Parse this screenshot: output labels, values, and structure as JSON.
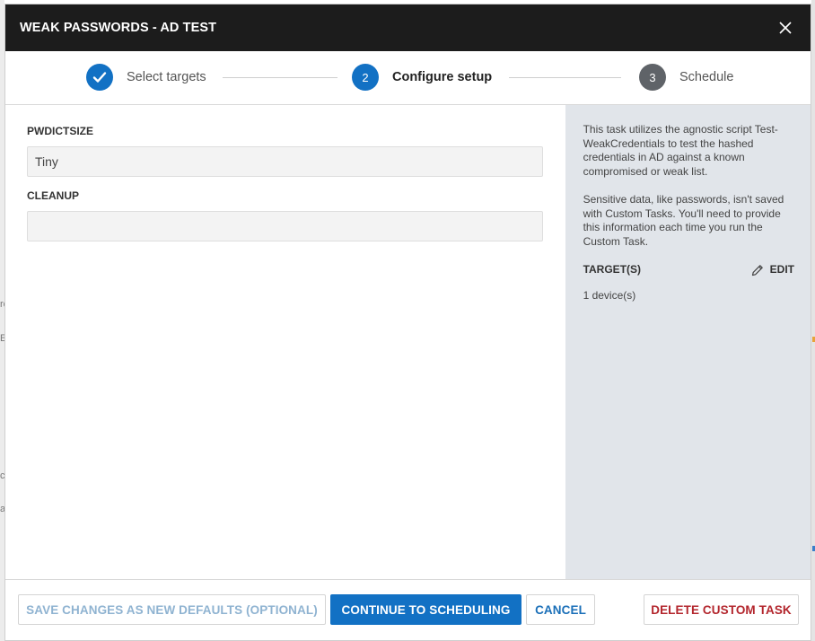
{
  "modal": {
    "title": "WEAK PASSWORDS - AD TEST"
  },
  "stepper": {
    "steps": [
      {
        "number": "",
        "label": "Select targets",
        "state": "complete"
      },
      {
        "number": "2",
        "label": "Configure setup",
        "state": "active"
      },
      {
        "number": "3",
        "label": "Schedule",
        "state": "pending"
      }
    ]
  },
  "form": {
    "fields": [
      {
        "label": "PWDICTSIZE",
        "value": "Tiny"
      },
      {
        "label": "CLEANUP",
        "value": ""
      }
    ]
  },
  "side_panel": {
    "description": "This task utilizes the agnostic script Test-WeakCredentials to test the hashed credentials in AD against a known compromised or weak list.",
    "notice": "Sensitive data, like passwords, isn't saved with Custom Tasks. You'll need to provide this information each time you run the Custom Task.",
    "targets_label": "TARGET(S)",
    "edit_label": "EDIT",
    "targets_count": "1 device(s)"
  },
  "footer": {
    "save_defaults_label": "SAVE CHANGES AS NEW DEFAULTS (OPTIONAL)",
    "continue_label": "CONTINUE TO SCHEDULING",
    "cancel_label": "CANCEL",
    "delete_label": "DELETE CUSTOM TASK"
  },
  "background": {
    "peek_glyphs": [
      "ro",
      "Ei",
      "c",
      "a"
    ]
  },
  "colors": {
    "header_bg": "#1c1c1c",
    "step_complete": "#1271c4",
    "step_active": "#1271c4",
    "step_pending": "#5f6368",
    "primary_button": "#1271c4",
    "danger_text": "#b3262d",
    "side_panel_bg": "#e1e5ea"
  },
  "icons": {
    "close": "close-icon",
    "check": "checkmark-icon",
    "edit": "pencil-icon"
  }
}
